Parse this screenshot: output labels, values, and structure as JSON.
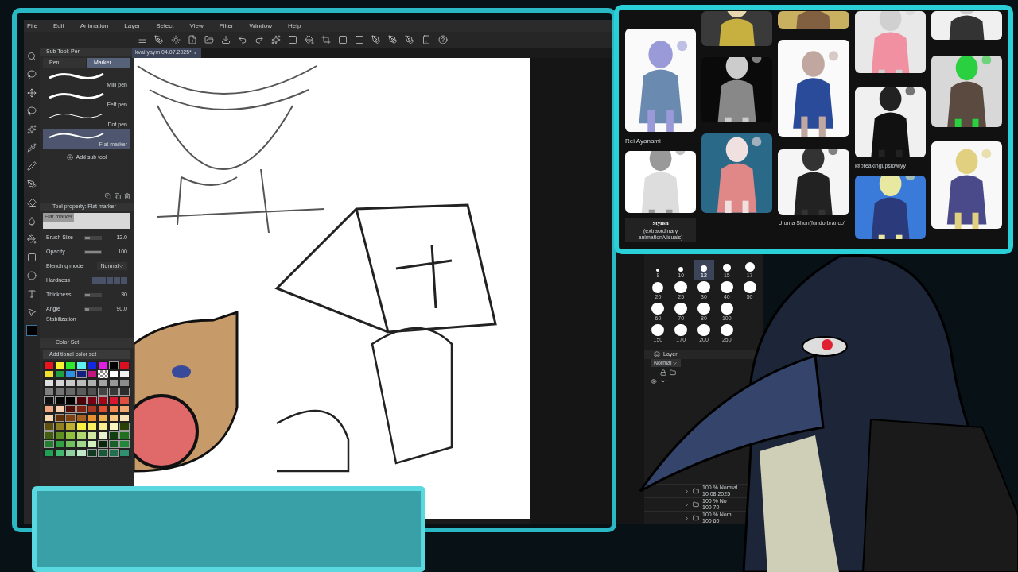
{
  "menu": [
    "File",
    "Edit",
    "Animation",
    "Layer",
    "Select",
    "View",
    "Filter",
    "Window",
    "Help"
  ],
  "document_tab": {
    "title": "kvai yayın 04.07.2025*"
  },
  "sub_tool": {
    "title": "Sub Tool: Pen",
    "groups": [
      {
        "label": "Pen",
        "selected": false
      },
      {
        "label": "Marker",
        "selected": true
      }
    ],
    "items": [
      {
        "label": "Milli pen",
        "selected": false
      },
      {
        "label": "Felt pen",
        "selected": false
      },
      {
        "label": "Dot pen",
        "selected": false
      },
      {
        "label": "Flat marker",
        "selected": true
      }
    ],
    "add_label": "Add sub tool"
  },
  "tool_property": {
    "title": "Tool property: Flat marker",
    "preview_label": "Flat marker",
    "rows": [
      {
        "kind": "slider",
        "label": "Brush Size",
        "value": "12.0",
        "level": 0.3
      },
      {
        "kind": "slider",
        "label": "Opacity",
        "value": "100",
        "level": 1
      },
      {
        "kind": "select",
        "label": "Blending mode",
        "value": "Normal"
      },
      {
        "kind": "hardness",
        "label": "Hardness"
      },
      {
        "kind": "slider",
        "label": "Thickness",
        "value": "30",
        "level": 0.3
      },
      {
        "kind": "slider",
        "label": "Angle",
        "value": "90.0",
        "level": 0.25
      },
      {
        "kind": "label",
        "label": "Stabilization"
      }
    ]
  },
  "color_set": {
    "title": "Color Set",
    "set_name": "Additional color set",
    "rows": [
      [
        {
          "kind": "solid",
          "color": "#e8141e"
        },
        {
          "kind": "solid",
          "color": "#f8f030"
        },
        {
          "kind": "solid",
          "color": "#30e830"
        },
        {
          "kind": "solid",
          "color": "#60f0f0"
        },
        {
          "kind": "solid",
          "color": "#1428e0"
        },
        {
          "kind": "solid",
          "color": "#e020e0"
        },
        {
          "kind": "solid",
          "color": "#000000"
        },
        {
          "kind": "solid",
          "color": "#d81020"
        }
      ],
      [
        {
          "kind": "solid",
          "color": "#f0e030"
        },
        {
          "kind": "solid",
          "color": "#20a040"
        },
        {
          "kind": "solid",
          "color": "#3090e0"
        },
        {
          "kind": "solid",
          "color": "#142080"
        },
        {
          "kind": "solid",
          "color": "#c01880"
        },
        {
          "kind": "transparent"
        },
        {
          "kind": "solid",
          "color": "#ffffff"
        },
        {
          "kind": "solid",
          "color": "#f0f0f0"
        }
      ],
      [
        {
          "kind": "solid",
          "color": "#e0e0e0"
        },
        {
          "kind": "solid",
          "color": "#d4d4d4"
        },
        {
          "kind": "solid",
          "color": "#c8c8c8"
        },
        {
          "kind": "solid",
          "color": "#bcbcbc"
        },
        {
          "kind": "solid",
          "color": "#b0b0b0"
        },
        {
          "kind": "solid",
          "color": "#a4a4a4"
        },
        {
          "kind": "solid",
          "color": "#989898"
        },
        {
          "kind": "solid",
          "color": "#8c8c8c"
        }
      ],
      [
        {
          "kind": "solid",
          "color": "#808080"
        },
        {
          "kind": "solid",
          "color": "#747474"
        },
        {
          "kind": "solid",
          "color": "#686868"
        },
        {
          "kind": "solid",
          "color": "#5c5c5c"
        },
        {
          "kind": "solid",
          "color": "#505050"
        },
        {
          "kind": "solid",
          "color": "#444444"
        },
        {
          "kind": "solid",
          "color": "#383838"
        },
        {
          "kind": "solid",
          "color": "#2c2c2c"
        }
      ],
      [
        {
          "kind": "solid",
          "color": "#101010"
        },
        {
          "kind": "solid",
          "color": "#080808"
        },
        {
          "kind": "solid",
          "color": "#000000"
        },
        {
          "kind": "solid",
          "color": "#500008"
        },
        {
          "kind": "solid",
          "color": "#780010"
        },
        {
          "kind": "solid",
          "color": "#a00818"
        },
        {
          "kind": "solid",
          "color": "#d81830"
        },
        {
          "kind": "solid",
          "color": "#e05040"
        }
      ],
      [
        {
          "kind": "solid",
          "color": "#f0a880"
        },
        {
          "kind": "solid",
          "color": "#f8d0b0"
        },
        {
          "kind": "solid",
          "color": "#501008"
        },
        {
          "kind": "solid",
          "color": "#802010"
        },
        {
          "kind": "solid",
          "color": "#a83820"
        },
        {
          "kind": "solid",
          "color": "#e05030"
        },
        {
          "kind": "solid",
          "color": "#f08850"
        },
        {
          "kind": "solid",
          "color": "#f0a870"
        }
      ],
      [
        {
          "kind": "solid",
          "color": "#f8d8b0"
        },
        {
          "kind": "solid",
          "color": "#603008"
        },
        {
          "kind": "solid",
          "color": "#804010"
        },
        {
          "kind": "solid",
          "color": "#a86020"
        },
        {
          "kind": "solid",
          "color": "#e89030"
        },
        {
          "kind": "solid",
          "color": "#f0b050"
        },
        {
          "kind": "solid",
          "color": "#f8c880"
        },
        {
          "kind": "solid",
          "color": "#f8e0b8"
        }
      ],
      [
        {
          "kind": "solid",
          "color": "#605010"
        },
        {
          "kind": "solid",
          "color": "#908020"
        },
        {
          "kind": "solid",
          "color": "#c0b030"
        },
        {
          "kind": "solid",
          "color": "#f8f040"
        },
        {
          "kind": "solid",
          "color": "#f8f060"
        },
        {
          "kind": "solid",
          "color": "#f8f090"
        },
        {
          "kind": "solid",
          "color": "#f8f8c0"
        },
        {
          "kind": "solid",
          "color": "#284008"
        }
      ],
      [
        {
          "kind": "solid",
          "color": "#406010"
        },
        {
          "kind": "solid",
          "color": "#609020"
        },
        {
          "kind": "solid",
          "color": "#90c040"
        },
        {
          "kind": "solid",
          "color": "#b0d870"
        },
        {
          "kind": "solid",
          "color": "#d0e8a0"
        },
        {
          "kind": "solid",
          "color": "#e8f0d0"
        },
        {
          "kind": "solid",
          "color": "#104010"
        },
        {
          "kind": "solid",
          "color": "#207020"
        }
      ],
      [
        {
          "kind": "solid",
          "color": "#208030"
        },
        {
          "kind": "solid",
          "color": "#30a040"
        },
        {
          "kind": "solid",
          "color": "#70c060"
        },
        {
          "kind": "solid",
          "color": "#a0d890"
        },
        {
          "kind": "solid",
          "color": "#d0f0c0"
        },
        {
          "kind": "solid",
          "color": "#082808"
        },
        {
          "kind": "solid",
          "color": "#186028"
        },
        {
          "kind": "solid",
          "color": "#208838"
        }
      ],
      [
        {
          "kind": "solid",
          "color": "#20a050"
        },
        {
          "kind": "solid",
          "color": "#40b870"
        },
        {
          "kind": "solid",
          "color": "#90d0a0"
        },
        {
          "kind": "solid",
          "color": "#c0e8c8"
        },
        {
          "kind": "solid",
          "color": "#103820"
        },
        {
          "kind": "solid",
          "color": "#185838"
        },
        {
          "kind": "solid",
          "color": "#207050"
        },
        {
          "kind": "solid",
          "color": "#309070"
        }
      ]
    ]
  },
  "brush_sizes": [
    {
      "label": "8",
      "selected": false
    },
    {
      "label": "10",
      "selected": false
    },
    {
      "label": "12",
      "selected": true
    },
    {
      "label": "15",
      "selected": false
    },
    {
      "label": "17",
      "selected": false
    },
    {
      "label": "20",
      "selected": false
    },
    {
      "label": "25",
      "selected": false
    },
    {
      "label": "30",
      "selected": false
    },
    {
      "label": "40",
      "selected": false
    },
    {
      "label": "50",
      "selected": false
    },
    {
      "label": "60",
      "selected": false
    },
    {
      "label": "70",
      "selected": false
    },
    {
      "label": "80",
      "selected": false
    },
    {
      "label": "100",
      "selected": false
    },
    {
      "label": "150",
      "selected": false
    },
    {
      "label": "170",
      "selected": false
    },
    {
      "label": "200",
      "selected": false
    },
    {
      "label": "250",
      "selected": false
    }
  ],
  "layer_panel": {
    "title": "Layer",
    "blend_mode": "Normal",
    "layers": [
      {
        "mode": "100 % Normal",
        "name": "10.08.2025"
      },
      {
        "mode": "100 % No",
        "name": "100 70"
      },
      {
        "mode": "100 % Nom",
        "name": "100 60"
      }
    ]
  },
  "board": {
    "captions": [
      "Rei Ayanami",
      "@breakingupslowlyy",
      "Uruma Shun(fundo branco)"
    ],
    "stylish_title": "Stylish",
    "stylish_subtitle": "(extraordinary animation/visuals)"
  }
}
